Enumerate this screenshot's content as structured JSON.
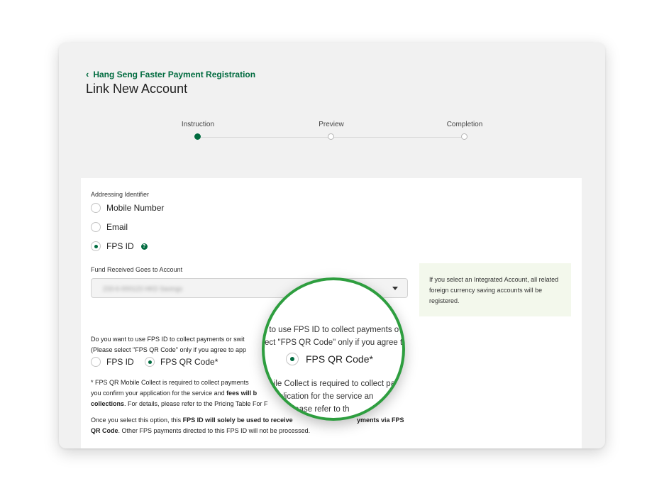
{
  "header": {
    "back_label": "Hang Seng Faster Payment Registration",
    "title": "Link New Account"
  },
  "stepper": {
    "steps": [
      {
        "label": "Instruction",
        "active": true
      },
      {
        "label": "Preview",
        "active": false
      },
      {
        "label": "Completion",
        "active": false
      }
    ]
  },
  "form": {
    "addressing_label": "Addressing Identifier",
    "identifier_options": [
      {
        "label": "Mobile Number",
        "checked": false
      },
      {
        "label": "Email",
        "checked": false
      },
      {
        "label": "FPS ID",
        "checked": true
      }
    ],
    "account_label": "Fund Received Goes to Account",
    "account_value": "233-6-000123 HKD Savings",
    "note": "If you select an Integrated Account, all related foreign currency saving accounts will be registered.",
    "question_line1": "Do you want to use FPS ID to collect payments or swit",
    "question_line2": "(Please select \"FPS QR Code\" only if you agree to app",
    "collect_options": [
      {
        "label": "FPS ID",
        "checked": false
      },
      {
        "label": "FPS QR Code*",
        "checked": true
      }
    ],
    "footnote_line1": "* FPS QR Mobile Collect is required to collect payments",
    "footnote_line2_pre": "you confirm your application for the service and ",
    "footnote_line2_bold": "fees will b",
    "footnote_line3_bold": "collections",
    "footnote_line3_post": ". For details, please refer to the Pricing Table For F",
    "once_pre": "Once you select this option, this ",
    "once_bold": "FPS ID will solely be used to receive",
    "once_bold_right": "yments via FPS",
    "once_line2_bold": "QR Code",
    "once_line2_post": ". Other FPS payments directed to this FPS ID will not be processed."
  },
  "magnifier": {
    "line1": "t to use FPS ID to collect payments o",
    "line2": "ect \"FPS QR Code\" only if you agree to",
    "radio_label": "FPS QR Code*",
    "line3": "obile Collect is required to collect pa",
    "line4": "r application for the service an",
    "line5": "etails, please refer to th"
  },
  "colors": {
    "brand_green": "#006b3f",
    "magnifier_ring": "#2e9e3f",
    "note_bg": "#f3f8ec"
  }
}
